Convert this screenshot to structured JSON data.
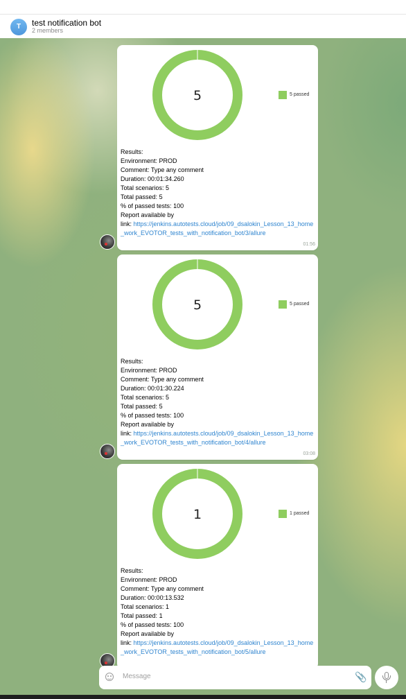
{
  "header": {
    "avatar_letter": "T",
    "title": "test notification bot",
    "subtitle": "2 members"
  },
  "messages": [
    {
      "chart_data": {
        "type": "pie",
        "series": [
          {
            "name": "passed",
            "values": [
              5
            ]
          }
        ],
        "center_label": "5",
        "legend": "5 passed"
      },
      "lines": {
        "results": "Results:",
        "environment_label": "Environment:",
        "environment": "PROD",
        "comment_label": "Comment:",
        "comment": "Type any comment",
        "duration_label": "Duration:",
        "duration": "00:01:34.260",
        "total_scenarios_label": "Total scenarios:",
        "total_scenarios": "5",
        "total_passed_label": "Total passed:",
        "total_passed": "5",
        "passed_pct_label": "% of passed tests:",
        "passed_pct": "100",
        "report_label_1": "Report available by",
        "report_label_2": "link:",
        "link": "https://jenkins.autotests.cloud/job/09_dsalokin_Lesson_13_home_work_EVOTOR_tests_with_notification_bot/3/allure"
      },
      "time": "01:56"
    },
    {
      "chart_data": {
        "type": "pie",
        "series": [
          {
            "name": "passed",
            "values": [
              5
            ]
          }
        ],
        "center_label": "5",
        "legend": "5 passed"
      },
      "lines": {
        "results": "Results:",
        "environment_label": "Environment:",
        "environment": "PROD",
        "comment_label": "Comment:",
        "comment": "Type any comment",
        "duration_label": "Duration:",
        "duration": "00:01:30.224",
        "total_scenarios_label": "Total scenarios:",
        "total_scenarios": "5",
        "total_passed_label": "Total passed:",
        "total_passed": "5",
        "passed_pct_label": "% of passed tests:",
        "passed_pct": "100",
        "report_label_1": "Report available by",
        "report_label_2": "link:",
        "link": "https://jenkins.autotests.cloud/job/09_dsalokin_Lesson_13_home_work_EVOTOR_tests_with_notification_bot/4/allure"
      },
      "time": "03:08"
    },
    {
      "chart_data": {
        "type": "pie",
        "series": [
          {
            "name": "passed",
            "values": [
              1
            ]
          }
        ],
        "center_label": "1",
        "legend": "1 passed"
      },
      "lines": {
        "results": "Results:",
        "environment_label": "Environment:",
        "environment": "PROD",
        "comment_label": "Comment:",
        "comment": "Type any comment",
        "duration_label": "Duration:",
        "duration": "00:00:13.532",
        "total_scenarios_label": "Total scenarios:",
        "total_scenarios": "1",
        "total_passed_label": "Total passed:",
        "total_passed": "1",
        "passed_pct_label": "% of passed tests:",
        "passed_pct": "100",
        "report_label_1": "Report available by",
        "report_label_2": "link:",
        "link": "https://jenkins.autotests.cloud/job/09_dsalokin_Lesson_13_home_work_EVOTOR_tests_with_notification_bot/5/allure"
      },
      "time": ""
    }
  ],
  "composer": {
    "placeholder": "Message",
    "emoji_icon": "smile-icon",
    "attach_icon": "paperclip-icon",
    "mic_icon": "microphone-icon"
  },
  "colors": {
    "passed": "#8fcd5f",
    "link": "#2e84cf"
  }
}
